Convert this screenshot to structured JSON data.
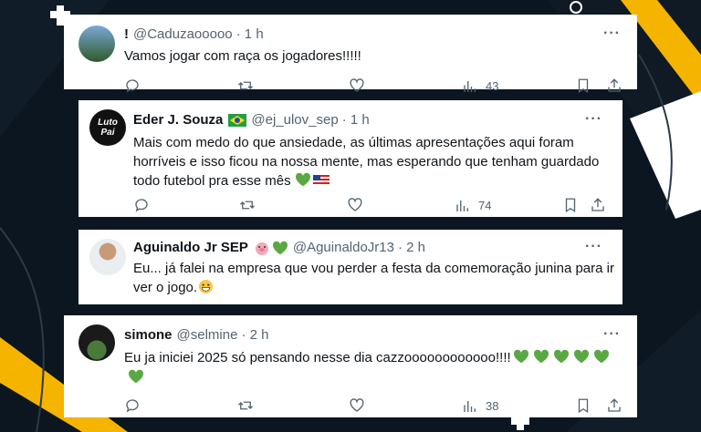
{
  "colors": {
    "background": "#0c1620",
    "accent_yellow": "#f5b400",
    "heart_green": "#5aa844",
    "meta_gray": "#536471"
  },
  "tweets": [
    {
      "name": "!",
      "handle": "@Caduzaooooo",
      "time": "· 1 h",
      "text": "Vamos jogar com raça os jogadores!!!!!",
      "emojis": [],
      "views": "43"
    },
    {
      "name": "Eder J. Souza",
      "handle": "@ej_ulov_sep",
      "time": "· 1 h",
      "text": "Mais com medo do que ansiedade, as últimas apresentações aqui foram\nhorríveis e isso ficou na nossa mente, mas esperando que tenham guardado\ntodo futebol pra esse mês",
      "avatar_text": "Luto\nPai",
      "emojis": [
        "green-heart",
        "us-flag"
      ],
      "name_badge": "brazil-flag",
      "views": "74"
    },
    {
      "name": "Aguinaldo Jr SEP",
      "handle": "@AguinaldoJr13",
      "time": "· 2 h",
      "text": "Eu... já falei na empresa que vou perder a festa da comemoração junina para ir\nver o jogo.",
      "emojis": [
        "grinning-face"
      ],
      "name_badge": "pig-heart",
      "views": ""
    },
    {
      "name": "simone",
      "handle": "@selmine",
      "time": "· 2 h",
      "text": "Eu ja iniciei 2025 só pensando nesse dia cazzoooooooooooo!!!!",
      "emojis": [
        "green-heart",
        "green-heart",
        "green-heart",
        "green-heart",
        "green-heart",
        "green-heart"
      ],
      "views": "38"
    }
  ],
  "icons": [
    "reply-icon",
    "retweet-icon",
    "like-icon",
    "views-icon",
    "bookmark-icon",
    "share-icon",
    "more-icon"
  ]
}
